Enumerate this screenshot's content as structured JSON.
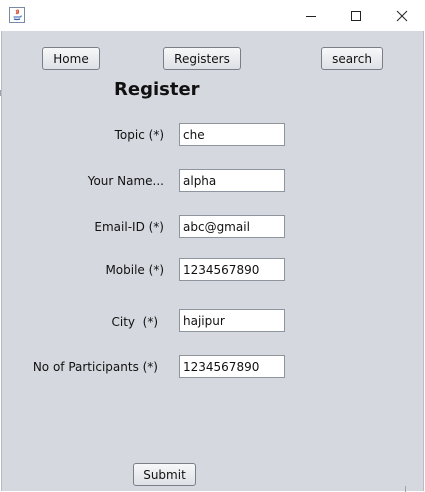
{
  "window": {
    "title": "",
    "controls": {
      "minimize": "minimize-icon",
      "maximize": "maximize-icon",
      "close": "close-icon"
    }
  },
  "nav": {
    "home_label": "Home",
    "registers_label": "Registers",
    "search_label": "search"
  },
  "form": {
    "heading": "Register",
    "fields": {
      "topic": {
        "label": "Topic (*)",
        "value": "che"
      },
      "name": {
        "label": "Your Name...",
        "value": "alpha"
      },
      "email": {
        "label": "Email-ID (*)",
        "value": "abc@gmail"
      },
      "mobile": {
        "label": "Mobile (*)",
        "value": "1234567890"
      },
      "city": {
        "label": "City  (*)",
        "value": "hajipur"
      },
      "participants": {
        "label": "No of Participants (*)",
        "value": "1234567890"
      }
    },
    "submit_label": "Submit"
  },
  "colors": {
    "panel_background": "#d5d8df",
    "titlebar_background": "#ffffff"
  }
}
